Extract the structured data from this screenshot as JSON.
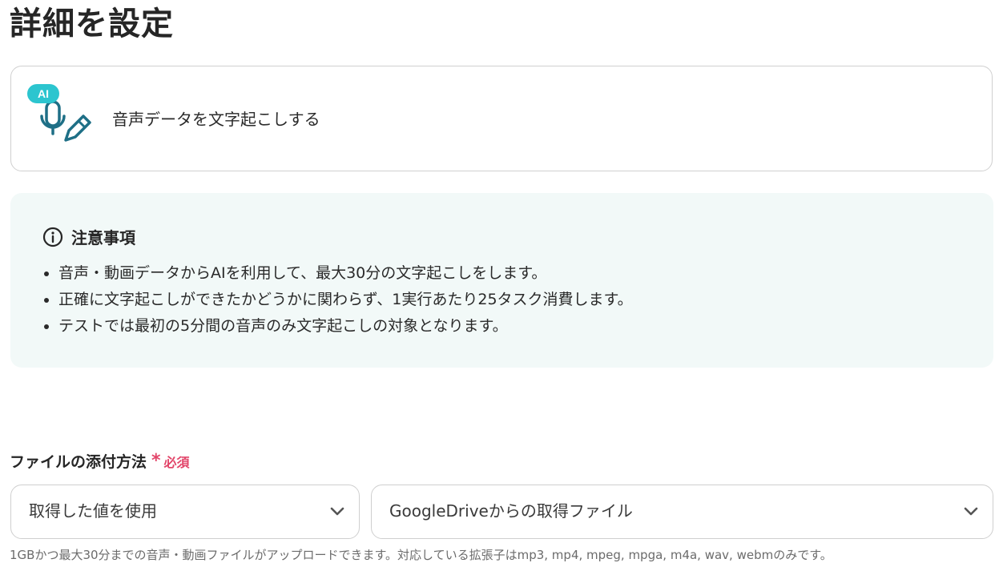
{
  "page": {
    "title": "詳細を設定"
  },
  "action": {
    "badge": "AI",
    "label": "音声データを文字起こしする",
    "icon": "microphone-pen-icon"
  },
  "notice": {
    "title": "注意事項",
    "icon": "info-icon",
    "items": [
      "音声・動画データからAIを利用して、最大30分の文字起こしをします。",
      "正確に文字起こしができたかどうかに関わらず、1実行あたり25タスク消費します。",
      "テストでは最初の5分間の音声のみ文字起こしの対象となります。"
    ]
  },
  "field": {
    "label": "ファイルの添付方法",
    "required_mark": "*",
    "required_text": "必須",
    "select_1": {
      "value": "取得した値を使用"
    },
    "select_2": {
      "value": "GoogleDriveからの取得ファイル"
    },
    "help": "1GBかつ最大30分までの音声・動画ファイルがアップロードできます。対応している拡張子はmp3, mp4, mpeg, mpga, m4a, wav, webmのみです。"
  },
  "colors": {
    "accent": "#2cc5cf",
    "icon": "#1e6f86",
    "required": "#e2466a",
    "notice_bg": "#f2f9f8"
  }
}
